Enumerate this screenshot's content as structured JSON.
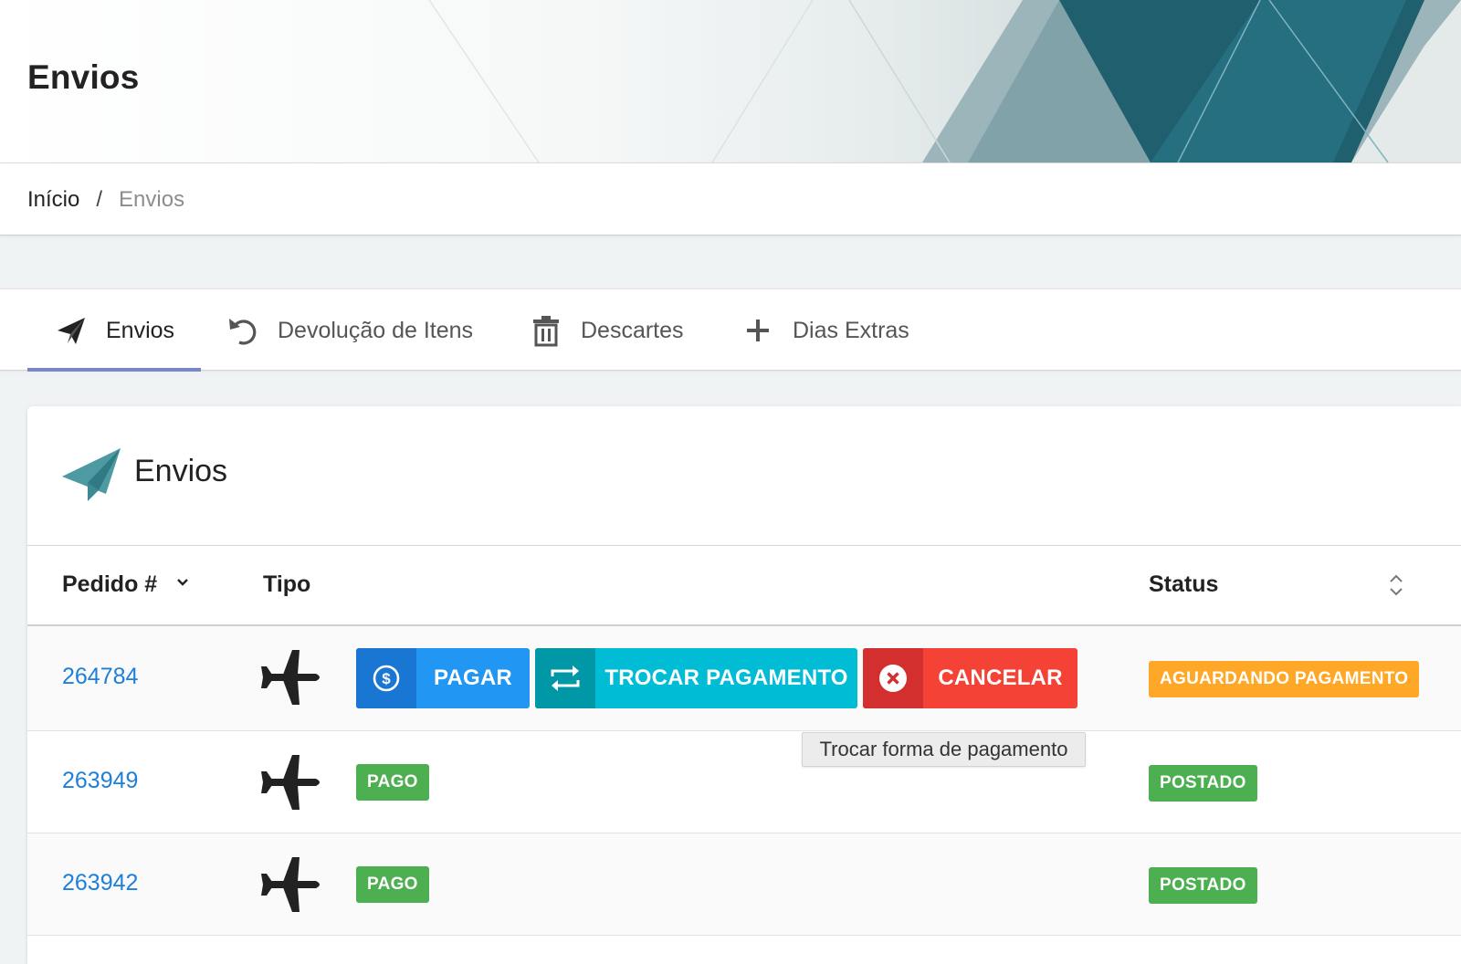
{
  "header": {
    "title": "Envios"
  },
  "breadcrumb": {
    "home": "Início",
    "separator": "/",
    "current": "Envios"
  },
  "tabs": [
    {
      "label": "Envios",
      "icon": "paper-plane-icon",
      "active": true
    },
    {
      "label": "Devolução de Itens",
      "icon": "undo-icon",
      "active": false
    },
    {
      "label": "Descartes",
      "icon": "trash-icon",
      "active": false
    },
    {
      "label": "Dias Extras",
      "icon": "plus-icon",
      "active": false
    }
  ],
  "card": {
    "title": "Envios",
    "icon": "paper-plane-icon",
    "columns": {
      "order": "Pedido #",
      "type": "Tipo",
      "status": "Status"
    }
  },
  "rows": [
    {
      "order": "264784",
      "type_icon": "airplane-icon",
      "payment": null,
      "status": "AGUARDANDO PAGAMENTO",
      "status_color": "#ffa726"
    },
    {
      "order": "263949",
      "type_icon": "airplane-icon",
      "payment": "PAGO",
      "status": "POSTADO",
      "status_color": "#4caf50"
    },
    {
      "order": "263942",
      "type_icon": "airplane-icon",
      "payment": "PAGO",
      "status": "POSTADO",
      "status_color": "#4caf50"
    }
  ],
  "actions": {
    "pay": "PAGAR",
    "swap": "TROCAR PAGAMENTO",
    "cancel": "CANCELAR"
  },
  "tooltip": "Trocar forma de pagamento",
  "colors": {
    "link": "#1e7fd8",
    "pay": "#2196f3",
    "swap": "#00bcd4",
    "cancel": "#f44336",
    "pending": "#ffa726",
    "success": "#4caf50",
    "tab_active": "#7986cb",
    "brand_teal": "#1f5f6e"
  }
}
